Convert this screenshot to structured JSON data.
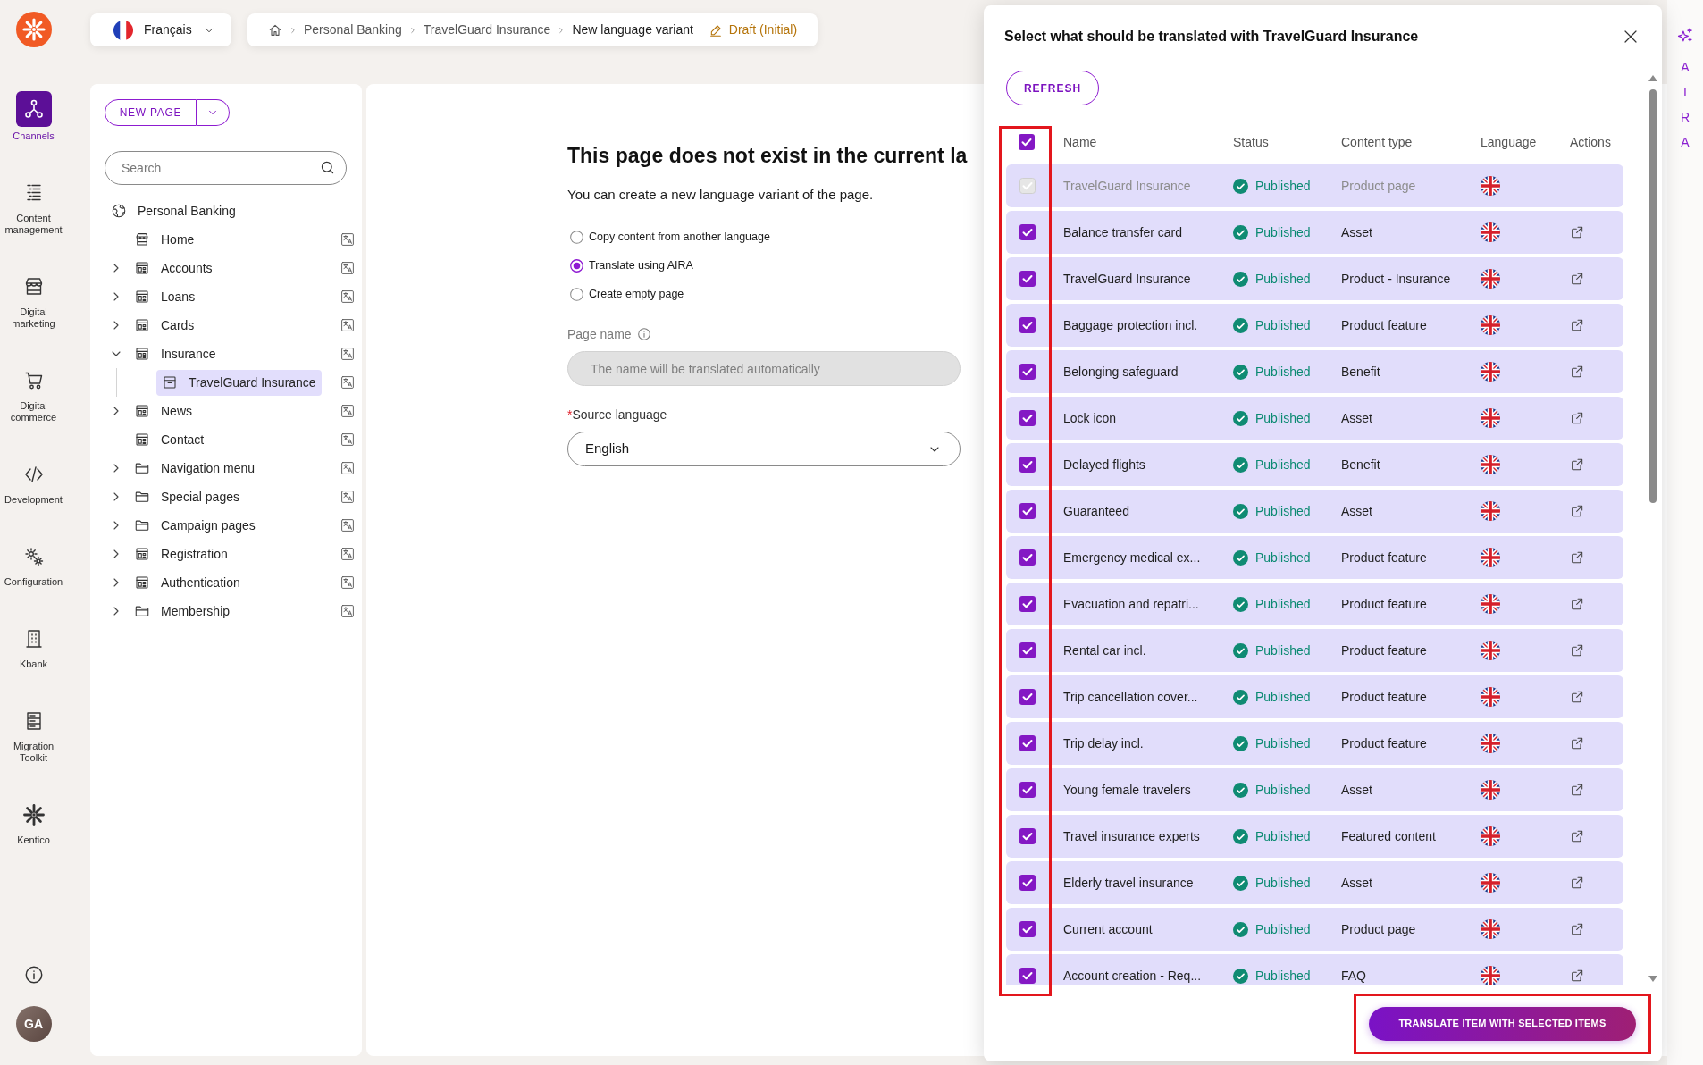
{
  "top_bar": {
    "language_selector": {
      "value": "Français"
    },
    "breadcrumb": {
      "items": [
        "Personal Banking",
        "TravelGuard Insurance",
        "New language variant"
      ],
      "status": "Draft (Initial)"
    }
  },
  "nav_rail": {
    "items": [
      {
        "label": "Channels",
        "selected": true
      },
      {
        "label": "Content management",
        "selected": false
      },
      {
        "label": "Digital marketing",
        "selected": false
      },
      {
        "label": "Digital commerce",
        "selected": false
      },
      {
        "label": "Development",
        "selected": false
      },
      {
        "label": "Configuration",
        "selected": false
      },
      {
        "label": "Kbank",
        "selected": false
      },
      {
        "label": "Migration Toolkit",
        "selected": false
      },
      {
        "label": "Kentico",
        "selected": false
      }
    ],
    "user": {
      "initials": "GA"
    }
  },
  "tree_panel": {
    "new_page_button": "NEW PAGE",
    "search": {
      "placeholder": "Search"
    },
    "tree": {
      "label": "Personal Banking",
      "kind": "site",
      "selected": false,
      "children": [
        {
          "label": "Home",
          "kind": "home",
          "expandable": false,
          "selected": false
        },
        {
          "label": "Accounts",
          "kind": "page",
          "expandable": true,
          "expanded": false,
          "selected": false
        },
        {
          "label": "Loans",
          "kind": "page",
          "expandable": true,
          "expanded": false,
          "selected": false
        },
        {
          "label": "Cards",
          "kind": "page",
          "expandable": true,
          "expanded": false,
          "selected": false
        },
        {
          "label": "Insurance",
          "kind": "page",
          "expandable": true,
          "expanded": true,
          "selected": false,
          "children": [
            {
              "label": "TravelGuard Insurance",
              "kind": "product",
              "expandable": false,
              "selected": true
            }
          ]
        },
        {
          "label": "News",
          "kind": "page",
          "expandable": true,
          "expanded": false,
          "selected": false
        },
        {
          "label": "Contact",
          "kind": "page",
          "expandable": false,
          "selected": false
        },
        {
          "label": "Navigation menu",
          "kind": "folder",
          "expandable": true,
          "expanded": false,
          "selected": false
        },
        {
          "label": "Special pages",
          "kind": "folder",
          "expandable": true,
          "expanded": false,
          "selected": false
        },
        {
          "label": "Campaign pages",
          "kind": "folder",
          "expandable": true,
          "expanded": false,
          "selected": false
        },
        {
          "label": "Registration",
          "kind": "page",
          "expandable": true,
          "expanded": false,
          "selected": false
        },
        {
          "label": "Authentication",
          "kind": "page",
          "expandable": true,
          "expanded": false,
          "selected": false
        },
        {
          "label": "Membership",
          "kind": "folder",
          "expandable": true,
          "expanded": false,
          "selected": false
        }
      ]
    }
  },
  "variant_form": {
    "heading": "This page does not exist in the current la",
    "subtitle": "You can create a new language variant of the page.",
    "options": [
      {
        "label": "Copy content from another language",
        "selected": false
      },
      {
        "label": "Translate using AIRA",
        "selected": true
      },
      {
        "label": "Create empty page",
        "selected": false
      }
    ],
    "page_name": {
      "label": "Page name",
      "placeholder": "The name will be translated automatically",
      "disabled": true
    },
    "source_language": {
      "required_mark": "*",
      "label": "Source language",
      "value": "English"
    }
  },
  "dialog": {
    "title": "Select what should be translated with TravelGuard Insurance",
    "refresh_button": "REFRESH",
    "table": {
      "columns": [
        "Name",
        "Status",
        "Content type",
        "Language",
        "Actions"
      ],
      "all_checked": true,
      "checkbox_column_highlighted": true,
      "rows": [
        {
          "name": "TravelGuard Insurance",
          "status": "Published",
          "content_type": "Product page",
          "checked": true,
          "disabled": true
        },
        {
          "name": "Balance transfer card",
          "status": "Published",
          "content_type": "Asset",
          "checked": true,
          "disabled": false
        },
        {
          "name": "TravelGuard Insurance",
          "status": "Published",
          "content_type": "Product - Insurance",
          "checked": true,
          "disabled": false
        },
        {
          "name": "Baggage protection incl.",
          "status": "Published",
          "content_type": "Product feature",
          "checked": true,
          "disabled": false
        },
        {
          "name": "Belonging safeguard",
          "status": "Published",
          "content_type": "Benefit",
          "checked": true,
          "disabled": false
        },
        {
          "name": "Lock icon",
          "status": "Published",
          "content_type": "Asset",
          "checked": true,
          "disabled": false
        },
        {
          "name": "Delayed flights",
          "status": "Published",
          "content_type": "Benefit",
          "checked": true,
          "disabled": false
        },
        {
          "name": "Guaranteed",
          "status": "Published",
          "content_type": "Asset",
          "checked": true,
          "disabled": false
        },
        {
          "name": "Emergency medical ex...",
          "status": "Published",
          "content_type": "Product feature",
          "checked": true,
          "disabled": false
        },
        {
          "name": "Evacuation and repatri...",
          "status": "Published",
          "content_type": "Product feature",
          "checked": true,
          "disabled": false
        },
        {
          "name": "Rental car incl.",
          "status": "Published",
          "content_type": "Product feature",
          "checked": true,
          "disabled": false
        },
        {
          "name": "Trip cancellation cover...",
          "status": "Published",
          "content_type": "Product feature",
          "checked": true,
          "disabled": false
        },
        {
          "name": "Trip delay incl.",
          "status": "Published",
          "content_type": "Product feature",
          "checked": true,
          "disabled": false
        },
        {
          "name": "Young female travelers",
          "status": "Published",
          "content_type": "Asset",
          "checked": true,
          "disabled": false
        },
        {
          "name": "Travel insurance experts",
          "status": "Published",
          "content_type": "Featured content",
          "checked": true,
          "disabled": false
        },
        {
          "name": "Elderly travel insurance",
          "status": "Published",
          "content_type": "Asset",
          "checked": true,
          "disabled": false
        },
        {
          "name": "Current account",
          "status": "Published",
          "content_type": "Product page",
          "checked": true,
          "disabled": false
        },
        {
          "name": "Account creation - Req...",
          "status": "Published",
          "content_type": "FAQ",
          "checked": true,
          "disabled": false
        }
      ]
    },
    "translate_button": {
      "label": "TRANSLATE ITEM WITH SELECTED ITEMS",
      "highlighted": true
    }
  },
  "aira_tab": {
    "label": "AIRA"
  }
}
